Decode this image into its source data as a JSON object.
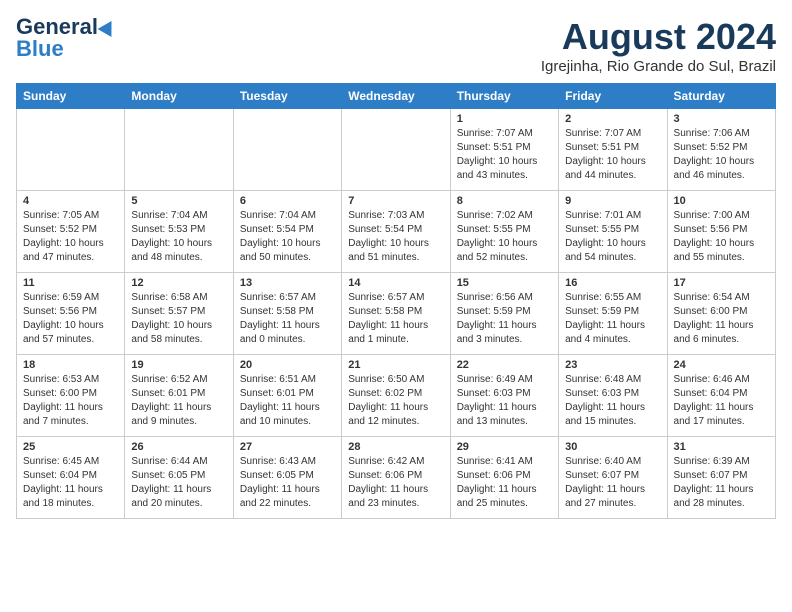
{
  "header": {
    "logo_general": "General",
    "logo_blue": "Blue",
    "month_title": "August 2024",
    "location": "Igrejinha, Rio Grande do Sul, Brazil"
  },
  "days_header": [
    "Sunday",
    "Monday",
    "Tuesday",
    "Wednesday",
    "Thursday",
    "Friday",
    "Saturday"
  ],
  "weeks": [
    [
      {
        "day": "",
        "content": []
      },
      {
        "day": "",
        "content": []
      },
      {
        "day": "",
        "content": []
      },
      {
        "day": "",
        "content": []
      },
      {
        "day": "1",
        "content": [
          "Sunrise: 7:07 AM",
          "Sunset: 5:51 PM",
          "Daylight: 10 hours",
          "and 43 minutes."
        ]
      },
      {
        "day": "2",
        "content": [
          "Sunrise: 7:07 AM",
          "Sunset: 5:51 PM",
          "Daylight: 10 hours",
          "and 44 minutes."
        ]
      },
      {
        "day": "3",
        "content": [
          "Sunrise: 7:06 AM",
          "Sunset: 5:52 PM",
          "Daylight: 10 hours",
          "and 46 minutes."
        ]
      }
    ],
    [
      {
        "day": "4",
        "content": [
          "Sunrise: 7:05 AM",
          "Sunset: 5:52 PM",
          "Daylight: 10 hours",
          "and 47 minutes."
        ]
      },
      {
        "day": "5",
        "content": [
          "Sunrise: 7:04 AM",
          "Sunset: 5:53 PM",
          "Daylight: 10 hours",
          "and 48 minutes."
        ]
      },
      {
        "day": "6",
        "content": [
          "Sunrise: 7:04 AM",
          "Sunset: 5:54 PM",
          "Daylight: 10 hours",
          "and 50 minutes."
        ]
      },
      {
        "day": "7",
        "content": [
          "Sunrise: 7:03 AM",
          "Sunset: 5:54 PM",
          "Daylight: 10 hours",
          "and 51 minutes."
        ]
      },
      {
        "day": "8",
        "content": [
          "Sunrise: 7:02 AM",
          "Sunset: 5:55 PM",
          "Daylight: 10 hours",
          "and 52 minutes."
        ]
      },
      {
        "day": "9",
        "content": [
          "Sunrise: 7:01 AM",
          "Sunset: 5:55 PM",
          "Daylight: 10 hours",
          "and 54 minutes."
        ]
      },
      {
        "day": "10",
        "content": [
          "Sunrise: 7:00 AM",
          "Sunset: 5:56 PM",
          "Daylight: 10 hours",
          "and 55 minutes."
        ]
      }
    ],
    [
      {
        "day": "11",
        "content": [
          "Sunrise: 6:59 AM",
          "Sunset: 5:56 PM",
          "Daylight: 10 hours",
          "and 57 minutes."
        ]
      },
      {
        "day": "12",
        "content": [
          "Sunrise: 6:58 AM",
          "Sunset: 5:57 PM",
          "Daylight: 10 hours",
          "and 58 minutes."
        ]
      },
      {
        "day": "13",
        "content": [
          "Sunrise: 6:57 AM",
          "Sunset: 5:58 PM",
          "Daylight: 11 hours",
          "and 0 minutes."
        ]
      },
      {
        "day": "14",
        "content": [
          "Sunrise: 6:57 AM",
          "Sunset: 5:58 PM",
          "Daylight: 11 hours",
          "and 1 minute."
        ]
      },
      {
        "day": "15",
        "content": [
          "Sunrise: 6:56 AM",
          "Sunset: 5:59 PM",
          "Daylight: 11 hours",
          "and 3 minutes."
        ]
      },
      {
        "day": "16",
        "content": [
          "Sunrise: 6:55 AM",
          "Sunset: 5:59 PM",
          "Daylight: 11 hours",
          "and 4 minutes."
        ]
      },
      {
        "day": "17",
        "content": [
          "Sunrise: 6:54 AM",
          "Sunset: 6:00 PM",
          "Daylight: 11 hours",
          "and 6 minutes."
        ]
      }
    ],
    [
      {
        "day": "18",
        "content": [
          "Sunrise: 6:53 AM",
          "Sunset: 6:00 PM",
          "Daylight: 11 hours",
          "and 7 minutes."
        ]
      },
      {
        "day": "19",
        "content": [
          "Sunrise: 6:52 AM",
          "Sunset: 6:01 PM",
          "Daylight: 11 hours",
          "and 9 minutes."
        ]
      },
      {
        "day": "20",
        "content": [
          "Sunrise: 6:51 AM",
          "Sunset: 6:01 PM",
          "Daylight: 11 hours",
          "and 10 minutes."
        ]
      },
      {
        "day": "21",
        "content": [
          "Sunrise: 6:50 AM",
          "Sunset: 6:02 PM",
          "Daylight: 11 hours",
          "and 12 minutes."
        ]
      },
      {
        "day": "22",
        "content": [
          "Sunrise: 6:49 AM",
          "Sunset: 6:03 PM",
          "Daylight: 11 hours",
          "and 13 minutes."
        ]
      },
      {
        "day": "23",
        "content": [
          "Sunrise: 6:48 AM",
          "Sunset: 6:03 PM",
          "Daylight: 11 hours",
          "and 15 minutes."
        ]
      },
      {
        "day": "24",
        "content": [
          "Sunrise: 6:46 AM",
          "Sunset: 6:04 PM",
          "Daylight: 11 hours",
          "and 17 minutes."
        ]
      }
    ],
    [
      {
        "day": "25",
        "content": [
          "Sunrise: 6:45 AM",
          "Sunset: 6:04 PM",
          "Daylight: 11 hours",
          "and 18 minutes."
        ]
      },
      {
        "day": "26",
        "content": [
          "Sunrise: 6:44 AM",
          "Sunset: 6:05 PM",
          "Daylight: 11 hours",
          "and 20 minutes."
        ]
      },
      {
        "day": "27",
        "content": [
          "Sunrise: 6:43 AM",
          "Sunset: 6:05 PM",
          "Daylight: 11 hours",
          "and 22 minutes."
        ]
      },
      {
        "day": "28",
        "content": [
          "Sunrise: 6:42 AM",
          "Sunset: 6:06 PM",
          "Daylight: 11 hours",
          "and 23 minutes."
        ]
      },
      {
        "day": "29",
        "content": [
          "Sunrise: 6:41 AM",
          "Sunset: 6:06 PM",
          "Daylight: 11 hours",
          "and 25 minutes."
        ]
      },
      {
        "day": "30",
        "content": [
          "Sunrise: 6:40 AM",
          "Sunset: 6:07 PM",
          "Daylight: 11 hours",
          "and 27 minutes."
        ]
      },
      {
        "day": "31",
        "content": [
          "Sunrise: 6:39 AM",
          "Sunset: 6:07 PM",
          "Daylight: 11 hours",
          "and 28 minutes."
        ]
      }
    ]
  ]
}
